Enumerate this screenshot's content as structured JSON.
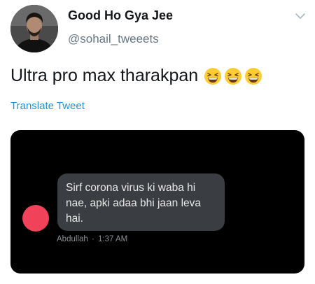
{
  "user": {
    "display_name": "Good Ho Gya Jee",
    "handle": "@sohail_tweeets"
  },
  "tweet": {
    "text": "Ultra pro max tharakpan",
    "emojis": [
      "grinning-squinting-face",
      "grinning-squinting-face",
      "grinning-squinting-face"
    ],
    "translate_label": "Translate Tweet"
  },
  "media": {
    "message_text": "Sirf corona virus ki waba hi nae, apki adaa bhi jaan leva hai.",
    "sender": "Abdullah",
    "separator": "·",
    "time": "1:37 AM"
  },
  "colors": {
    "link": "#1b95e0",
    "handle": "#657786",
    "dm_avatar": "#f0435a",
    "bubble": "#3a3d41"
  }
}
